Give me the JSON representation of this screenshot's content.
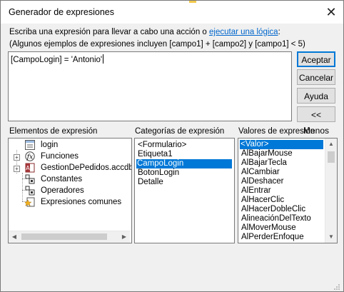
{
  "window": {
    "title": "Generador de expresiones",
    "close_glyph": "✕"
  },
  "instructions": {
    "prefix": "Escriba una expresión para llevar a cabo una acción o ",
    "link": "ejecutar una lógica",
    "suffix": ":"
  },
  "examples": "(Algunos ejemplos de expresiones incluyen [campo1] + [campo2] y [campo1] < 5)",
  "expression": {
    "value": "[CampoLogin] = 'Antonio'"
  },
  "buttons": {
    "accept": "Aceptar",
    "cancel": "Cancelar",
    "help": "Ayuda",
    "less": "<< Menos"
  },
  "elements": {
    "label": "Elementos de expresión",
    "items": [
      {
        "label": "login",
        "icon": "form-icon",
        "selected": true
      },
      {
        "label": "Funciones",
        "icon": "function-icon"
      },
      {
        "label": "GestionDePedidos.accdb",
        "icon": "database-icon"
      },
      {
        "label": "Constantes",
        "icon": "constants-icon"
      },
      {
        "label": "Operadores",
        "icon": "operators-icon"
      },
      {
        "label": "Expresiones comunes",
        "icon": "common-expressions-icon"
      }
    ]
  },
  "categories": {
    "label": "Categorías de expresión",
    "items": [
      "<Formulario>",
      "Etiqueta1",
      "CampoLogin",
      "BotonLogin",
      "Detalle"
    ],
    "selected": "CampoLogin"
  },
  "values": {
    "label": "Valores de expresión",
    "items": [
      "<Valor>",
      "AlBajarMouse",
      "AlBajarTecla",
      "AlCambiar",
      "AlDeshacer",
      "AlEntrar",
      "AlHacerClic",
      "AlHacerDobleClic",
      "AlineaciónDelTexto",
      "AlMoverMouse",
      "AlPerderEnfoque"
    ],
    "selected": "<Valor>"
  }
}
